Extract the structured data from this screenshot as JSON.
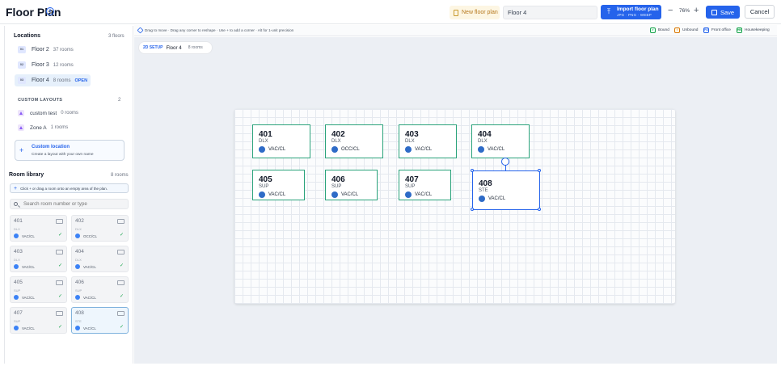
{
  "header": {
    "title": "Floor Plan",
    "info_icon": "info-icon",
    "new_floor_plan": "New floor plan",
    "floor_name_value": "Floor 4",
    "import": {
      "label": "Import floor plan",
      "formats": "JPG · PNG · WEBP"
    },
    "zoom": "76%",
    "save": "Save",
    "cancel": "Cancel",
    "accent": "#2563eb"
  },
  "sidebar": {
    "locations_title": "Locations",
    "locations_count": "3 floors",
    "locations": [
      {
        "badge": "01",
        "name": "Floor 2",
        "rooms": "37 rooms"
      },
      {
        "badge": "02",
        "name": "Floor 3",
        "rooms": "12 rooms"
      },
      {
        "badge": "03",
        "name": "Floor 4",
        "rooms": "8 rooms",
        "badge_open": "OPEN",
        "selected": true
      }
    ],
    "custom_layouts_title": "CUSTOM LAYOUTS",
    "custom_layouts_count": "2",
    "custom_layouts": [
      {
        "name": "custom test",
        "rooms": "0 rooms"
      },
      {
        "name": "Zone A",
        "rooms": "1 rooms"
      }
    ],
    "custom_location": {
      "title": "Custom location",
      "subtitle": "Create a layout with your own name"
    },
    "room_library_title": "Room library",
    "room_library_count": "8 rooms",
    "library_hint": "Click + or drag a room onto an empty area of the plan.",
    "search_placeholder": "Search room number or type",
    "library": [
      {
        "num": "401",
        "type": "DLX",
        "status": "VAC/CL"
      },
      {
        "num": "402",
        "type": "DLX",
        "status": "OCC/CL"
      },
      {
        "num": "403",
        "type": "DLX",
        "status": "VAC/CL"
      },
      {
        "num": "404",
        "type": "DLX",
        "status": "VAC/CL"
      },
      {
        "num": "405",
        "type": "SUP",
        "status": "VAC/CL"
      },
      {
        "num": "406",
        "type": "SUP",
        "status": "VAC/CL"
      },
      {
        "num": "407",
        "type": "SUP",
        "status": "VAC/CL"
      },
      {
        "num": "408",
        "type": "STE",
        "status": "VAC/CL",
        "selected": true
      }
    ]
  },
  "toolbar": {
    "hint": "Drag to move · Drag any corner to reshape · Use + to add a corner · Alt for 1-unit precision",
    "legend": [
      {
        "code": "✓",
        "label": "Bound",
        "color": "#16a34a"
      },
      {
        "code": "!",
        "label": "Unbound",
        "color": "#d97706"
      },
      {
        "code": "FO",
        "label": "Front office",
        "color": "#2563eb"
      },
      {
        "code": "HK",
        "label": "Housekeeping",
        "color": "#16a34a"
      }
    ]
  },
  "canvas": {
    "setup_tag": "2D SETUP",
    "floor_name": "Floor 4",
    "floor_rooms": "8 rooms",
    "rooms": [
      {
        "num": "401",
        "type": "DLX",
        "status": "VAC/CL"
      },
      {
        "num": "402",
        "type": "DLX",
        "status": "OCC/CL"
      },
      {
        "num": "403",
        "type": "DLX",
        "status": "VAC/CL"
      },
      {
        "num": "404",
        "type": "DLX",
        "status": "VAC/CL"
      },
      {
        "num": "405",
        "type": "SUP",
        "status": "VAC/CL"
      },
      {
        "num": "406",
        "type": "SUP",
        "status": "VAC/CL"
      },
      {
        "num": "407",
        "type": "SUP",
        "status": "VAC/CL"
      },
      {
        "num": "408",
        "type": "STE",
        "status": "VAC/CL",
        "selected": true
      }
    ]
  }
}
